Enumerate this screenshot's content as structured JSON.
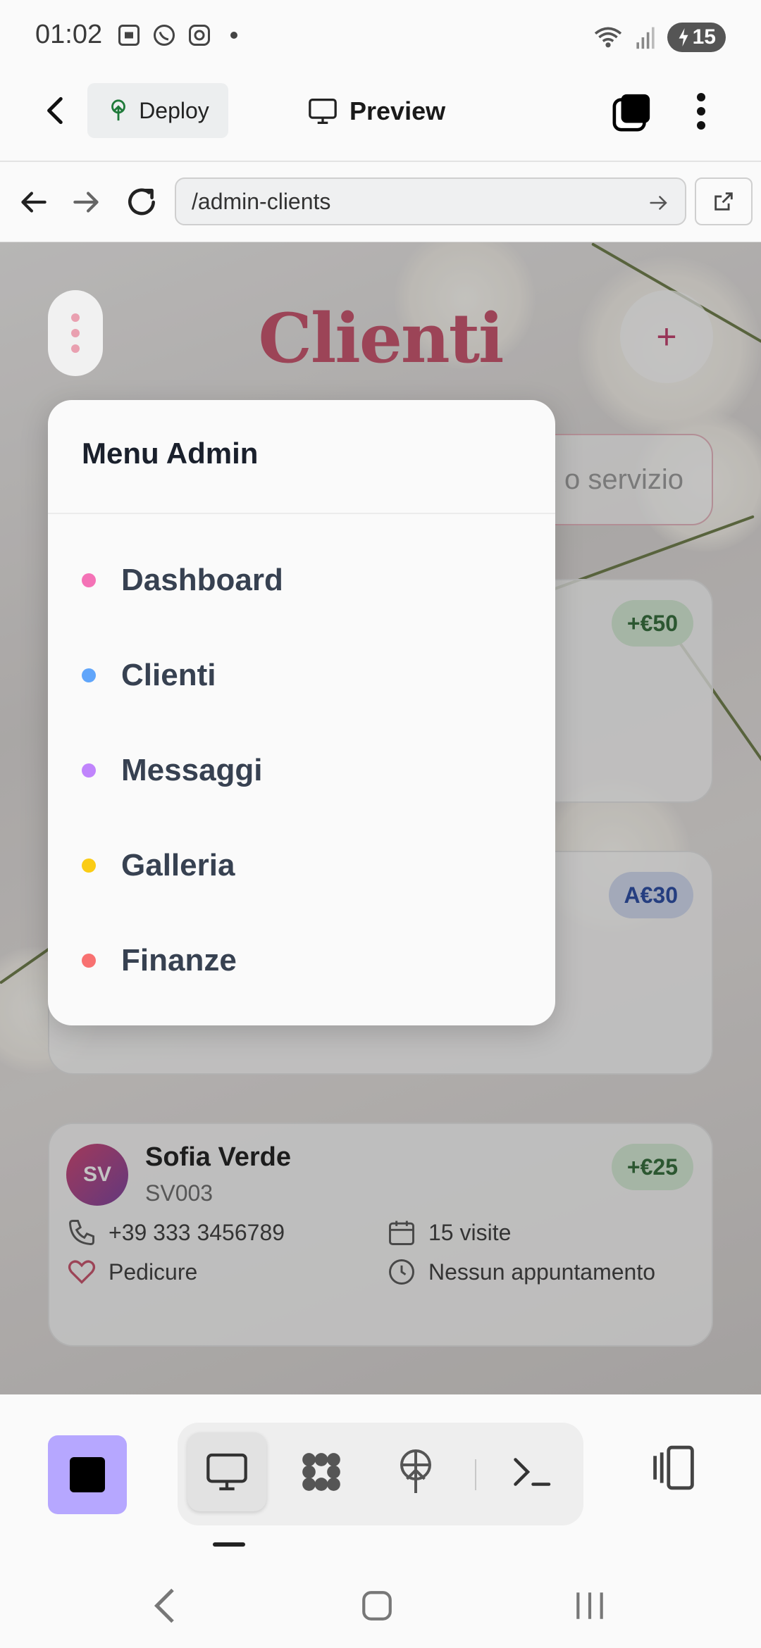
{
  "status_bar": {
    "time": "01:02",
    "battery": "15",
    "icons": [
      "screenshot-icon",
      "whatsapp-icon",
      "instagram-icon",
      "wifi-icon",
      "signal-icon",
      "battery-icon"
    ]
  },
  "header": {
    "deploy_label": "Deploy",
    "preview_label": "Preview"
  },
  "urlbar": {
    "url": "/admin-clients"
  },
  "page": {
    "title": "Clienti",
    "add_label": "+",
    "search_placeholder": "Cerca per nome, codice o servizio"
  },
  "clients": [
    {
      "initials": "SV",
      "name": "Sofia Verde",
      "code": "SV003",
      "phone": "+39 333 3456789",
      "visits": "15 visite",
      "service": "Pedicure",
      "appointment": "Nessun appuntamento",
      "balance": "+€25"
    }
  ],
  "hidden_badges": [
    "+€50",
    "A€30"
  ],
  "menu": {
    "title": "Menu Admin",
    "items": [
      {
        "label": "Dashboard",
        "color": "#f472b6"
      },
      {
        "label": "Clienti",
        "color": "#60a5fa"
      },
      {
        "label": "Messaggi",
        "color": "#c084fc"
      },
      {
        "label": "Galleria",
        "color": "#facc15"
      },
      {
        "label": "Finanze",
        "color": "#f87171"
      }
    ]
  },
  "colors": {
    "accent": "#c9506a",
    "stop_button": "#b6a7ff"
  }
}
